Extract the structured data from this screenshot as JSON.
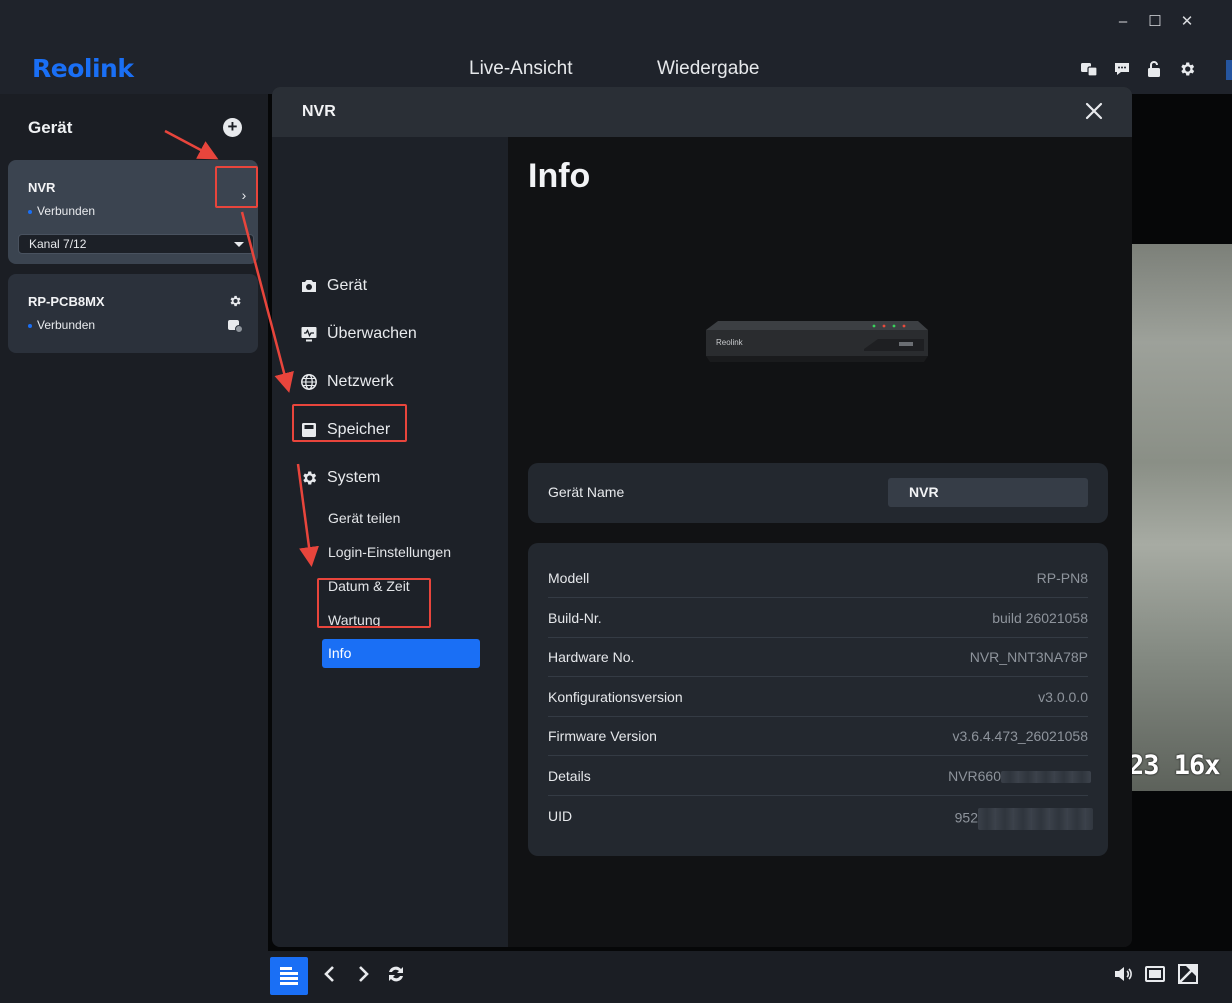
{
  "app": {
    "logo": "Reolink",
    "window_controls": {
      "minimize": "–",
      "maximize": "☐",
      "close": "✕"
    },
    "tabs": [
      {
        "label": "Live-Ansicht",
        "active": true
      },
      {
        "label": "Wiedergabe",
        "active": false
      }
    ],
    "accent_color": "#1a6ff5"
  },
  "sidebar": {
    "title": "Gerät",
    "devices": [
      {
        "name": "NVR",
        "status": "Verbunden",
        "channel": "Kanal 7/12"
      },
      {
        "name": "RP-PCB8MX",
        "status": "Verbunden"
      }
    ]
  },
  "video": {
    "osd_text": "23 16x"
  },
  "modal": {
    "title": "NVR",
    "nav": [
      {
        "label": "Gerät",
        "icon": "camera-icon"
      },
      {
        "label": "Überwachen",
        "icon": "monitor-icon"
      },
      {
        "label": "Netzwerk",
        "icon": "globe-icon"
      },
      {
        "label": "Speicher",
        "icon": "storage-icon"
      },
      {
        "label": "System",
        "icon": "gear-icon"
      }
    ],
    "system_subitems": [
      "Gerät teilen",
      "Login-Einstellungen",
      "Datum & Zeit",
      "Wartung",
      "Info"
    ],
    "active_subitem": "Info",
    "content": {
      "title": "Info",
      "image_brand": "Reolink",
      "device_name_label": "Gerät Name",
      "device_name_value": "NVR",
      "rows": [
        {
          "label": "Modell",
          "value": "RP-PN8"
        },
        {
          "label": "Build-Nr.",
          "value": "build 26021058"
        },
        {
          "label": "Hardware No.",
          "value": "NVR_NNT3NA78P"
        },
        {
          "label": "Konfigurationsversion",
          "value": "v3.0.0.0"
        },
        {
          "label": "Firmware Version",
          "value": "v3.6.4.473_26021058"
        },
        {
          "label": "Details",
          "value": "NVR660"
        },
        {
          "label": "UID",
          "value": "952"
        }
      ]
    }
  }
}
